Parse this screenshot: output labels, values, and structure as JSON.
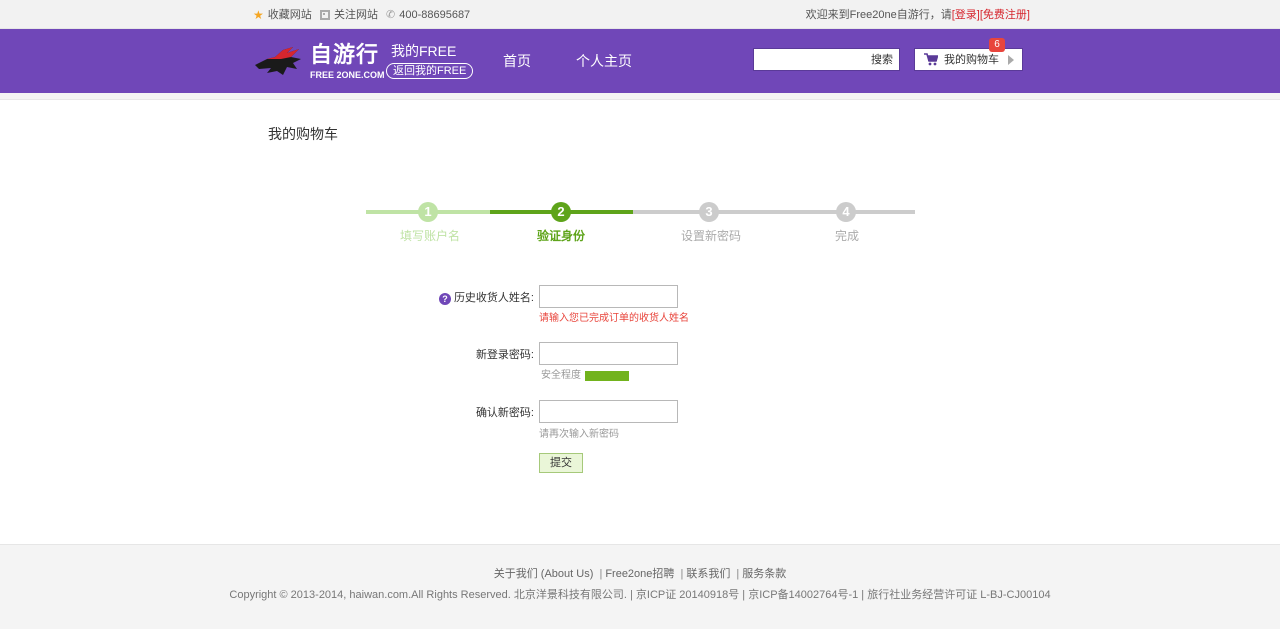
{
  "topbar": {
    "favorite": "收藏网站",
    "follow": "关注网站",
    "phone": "400-88695687",
    "welcome": "欢迎来到Free20ne自游行，请",
    "login": "[登录]",
    "register": "[免费注册]"
  },
  "header": {
    "logo_name": "自游行",
    "logo_sub": "FREE 2ONE.COM",
    "my_free": "我的FREE",
    "back_to_free": "返回我的FREE",
    "nav": [
      "首页",
      "个人主页"
    ],
    "search_placeholder": "",
    "search_button": "搜索",
    "cart_label": "我的购物车",
    "cart_count": "6"
  },
  "main": {
    "page_title": "我的购物车",
    "steps": [
      {
        "number": "1",
        "label": "填写账户名",
        "state": "done"
      },
      {
        "number": "2",
        "label": "验证身份",
        "state": "current"
      },
      {
        "number": "3",
        "label": "设置新密码",
        "state": "todo"
      },
      {
        "number": "4",
        "label": "完成",
        "state": "todo"
      }
    ],
    "form": {
      "history_name_label": "历史收货人姓名:",
      "history_name_value": "",
      "history_name_hint": "请输入您已完成订单的收货人姓名",
      "new_password_label": "新登录密码:",
      "new_password_value": "",
      "strength_label": "安全程度",
      "strength_level": 1.0,
      "confirm_password_label": "确认新密码:",
      "confirm_password_value": "",
      "confirm_hint": "请再次输入新密码",
      "submit": "提交"
    }
  },
  "footer": {
    "links": [
      "关于我们 (About Us)",
      "Free2one招聘",
      "联系我们",
      "服务条款"
    ],
    "copyright": "Copyright © 2013-2014, haiwan.com.All Rights Reserved. 北京洋景科技有限公司. | 京ICP证 20140918号 | 京ICP备14002764号-1 | 旅行社业务经营许可证 L-BJ-CJ00104"
  },
  "colors": {
    "brand_purple": "#7047b8",
    "step_done": "#bfe3a5",
    "step_current": "#5ea41a",
    "step_todo": "#cccccc",
    "error_red": "#e8453c",
    "strength_green": "#72b31d"
  }
}
